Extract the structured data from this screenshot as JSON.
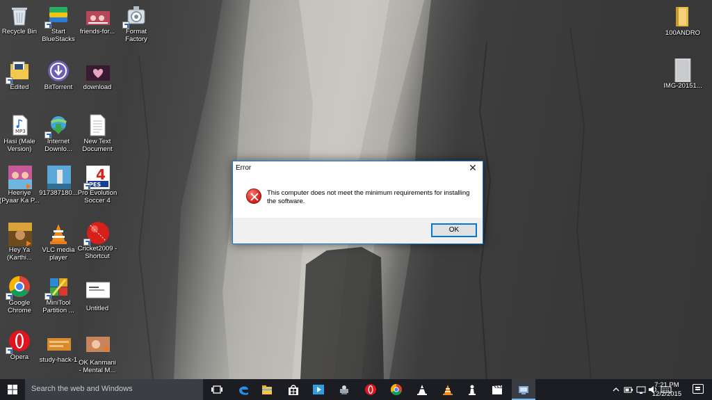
{
  "desktop": {
    "icons": [
      {
        "id": "recycle-bin",
        "label": "Recycle Bin",
        "icon": "recycle-bin-icon"
      },
      {
        "id": "bluestacks",
        "label": "Start\nBlueStacks",
        "icon": "bluestacks-icon"
      },
      {
        "id": "friends",
        "label": "friends-for...",
        "icon": "image-thumbnail-icon"
      },
      {
        "id": "format-factory",
        "label": "Format\nFactory",
        "icon": "format-factory-icon"
      },
      {
        "id": "edited",
        "label": "Edited",
        "icon": "folder-icon"
      },
      {
        "id": "bittorrent",
        "label": "BitTorrent",
        "icon": "bittorrent-icon"
      },
      {
        "id": "download",
        "label": "download",
        "icon": "image-thumbnail-icon"
      },
      {
        "id": "hasi",
        "label": "Hasi (Male\nVersion)",
        "icon": "mp3-file-icon"
      },
      {
        "id": "idm",
        "label": "Internet\nDownlo...",
        "icon": "internet-download-manager-icon"
      },
      {
        "id": "new-text",
        "label": "New Text\nDocument",
        "icon": "text-document-icon"
      },
      {
        "id": "heeriye",
        "label": "Heeriye\n(Pyaar Ka P...",
        "icon": "video-thumbnail-icon"
      },
      {
        "id": "img-917",
        "label": "917387180...",
        "icon": "image-thumbnail-icon"
      },
      {
        "id": "pes4",
        "label": "Pro Evolution\nSoccer 4",
        "icon": "pes4-icon"
      },
      {
        "id": "hey-ya",
        "label": "Hey Ya\n(Karthi...",
        "icon": "video-thumbnail-icon"
      },
      {
        "id": "vlc",
        "label": "VLC media\nplayer",
        "icon": "vlc-icon"
      },
      {
        "id": "cricket",
        "label": "Cricket2009 -\nShortcut",
        "icon": "cricket-ball-icon"
      },
      {
        "id": "chrome",
        "label": "Google\nChrome",
        "icon": "chrome-icon"
      },
      {
        "id": "minitool",
        "label": "MiniTool\nPartition ...",
        "icon": "minitool-icon"
      },
      {
        "id": "untitled",
        "label": "Untitled",
        "icon": "image-thumbnail-icon"
      },
      {
        "id": "opera",
        "label": "Opera",
        "icon": "opera-icon"
      },
      {
        "id": "study-hack",
        "label": "study-hack-1",
        "icon": "image-thumbnail-icon"
      },
      {
        "id": "ok-kanmani",
        "label": "OK Kanmani\n- Mental M...",
        "icon": "video-thumbnail-icon"
      },
      {
        "id": "100andro",
        "label": "100ANDRO",
        "icon": "folder-icon"
      },
      {
        "id": "img-2015",
        "label": "IMG-20151...",
        "icon": "image-thumbnail-icon"
      }
    ]
  },
  "dialog": {
    "title": "Error",
    "close_glyph": "✕",
    "message": "This computer does not meet the minimum requirements for installing the software.",
    "ok_label": "OK"
  },
  "taskbar": {
    "search_placeholder": "Search the web and Windows",
    "pinned": [
      "task-view-icon",
      "edge-icon",
      "file-explorer-icon",
      "store-icon",
      "media-player-icon",
      "network-icon",
      "opera-icon",
      "chrome-icon",
      "vlc-icon",
      "vlc-icon",
      "chess-icon",
      "clapperboard-icon",
      "bluestacks-icon"
    ],
    "tray": [
      "chevron-up-icon",
      "battery-icon",
      "network-icon",
      "volume-icon",
      "keyboard-icon"
    ],
    "time": "7:21 PM",
    "date": "12/2/2015"
  }
}
